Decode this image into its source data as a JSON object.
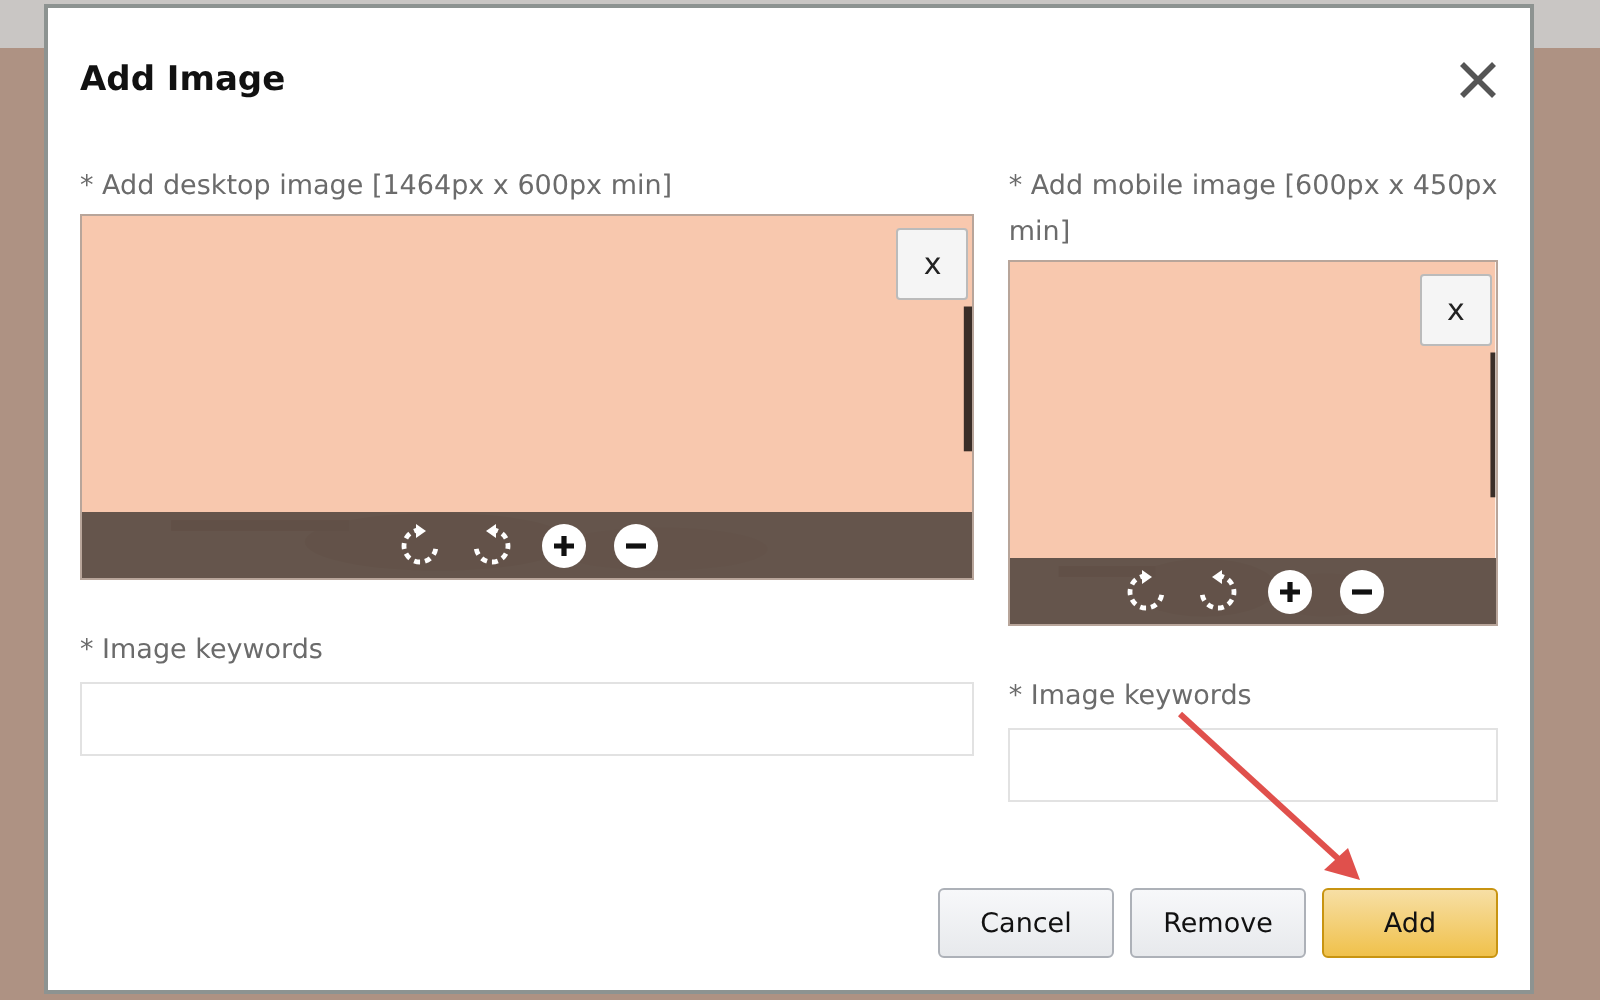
{
  "dialog": {
    "title": "Add Image",
    "panels": [
      {
        "kind": "desktop",
        "label": "* Add desktop image [1464px x 600px min]",
        "remove_button": "x",
        "keywords_label": "* Image keywords"
      },
      {
        "kind": "mobile",
        "label": "* Add mobile image [600px x 450px min]",
        "remove_button": "x",
        "keywords_label": "* Image keywords"
      }
    ],
    "buttons": [
      {
        "label": "Cancel",
        "kind": "secondary"
      },
      {
        "label": "Remove",
        "kind": "secondary"
      },
      {
        "label": "Add",
        "kind": "primary"
      }
    ]
  }
}
